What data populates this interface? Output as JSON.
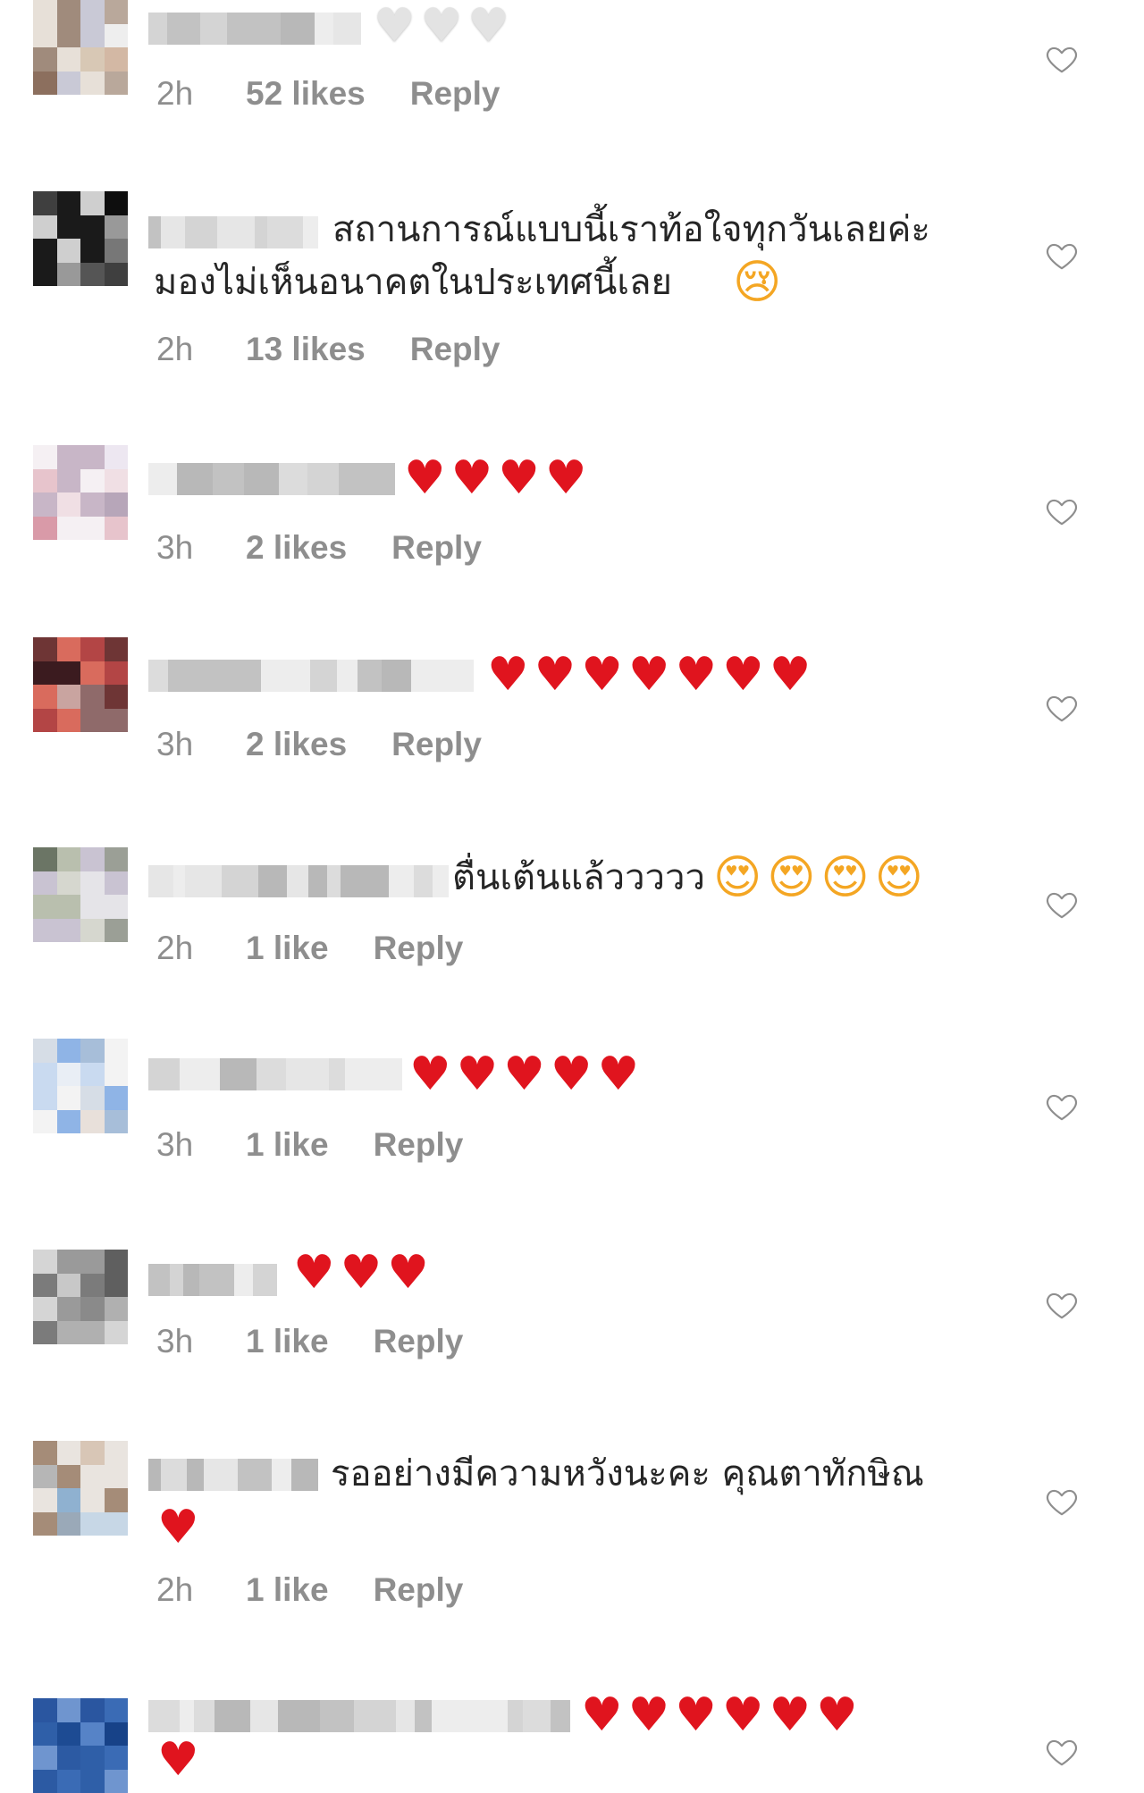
{
  "comments": [
    {
      "text": "",
      "text2": "",
      "emoji": "♥♥♥",
      "emoji_color": "white",
      "time": "2h",
      "likes": "52 likes",
      "reply": "Reply",
      "avatar_palette": [
        "#c9c9d6",
        "#b9a89b",
        "#d8c8b5",
        "#e7e0d8",
        "#a08b7c",
        "#8c6f5e",
        "#d3b8a4",
        "#eeeeee"
      ]
    },
    {
      "text": "สถานการณ์แบบนี้เราท้อใจทุกวันเลยค่ะ",
      "text2": "มองไม่เห็นอนาคตในประเทศนี้เลย",
      "emoji": "😢",
      "emoji_color": "face",
      "time": "2h",
      "likes": "13 likes",
      "reply": "Reply",
      "avatar_palette": [
        "#2b2b2b",
        "#555555",
        "#777777",
        "#1a1a1a",
        "#999999",
        "#3f3f3f",
        "#cfcfcf",
        "#0e0e0e"
      ]
    },
    {
      "text": "",
      "text2": "",
      "emoji": "♥♥♥♥",
      "emoji_color": "red",
      "time": "3h",
      "likes": "2 likes",
      "reply": "Reply",
      "avatar_palette": [
        "#e7c4cc",
        "#d99aa8",
        "#f0dfe4",
        "#c8b6c7",
        "#ede7f1",
        "#b7a6b9",
        "#d6e2ee",
        "#f5f0f3"
      ]
    },
    {
      "text": "",
      "text2": "",
      "emoji": "♥♥♥♥♥♥♥",
      "emoji_color": "red",
      "time": "3h",
      "likes": "2 likes",
      "reply": "Reply",
      "avatar_palette": [
        "#b34545",
        "#6e3535",
        "#d96b5d",
        "#3b1b1f",
        "#8f6a6a",
        "#c9a4a0",
        "#2a0d12",
        "#a7867a"
      ]
    },
    {
      "text": "ตื่นเต้นแล้ววววว",
      "text2": "",
      "emoji": "😍😍😍😍",
      "emoji_color": "face",
      "time": "2h",
      "likes": "1 like",
      "reply": "Reply",
      "avatar_palette": [
        "#8a9282",
        "#b9bfae",
        "#d6d7cf",
        "#6b7565",
        "#a6aaa0",
        "#e5e4e8",
        "#c9c3d2",
        "#9b9f96"
      ]
    },
    {
      "text": "",
      "text2": "",
      "emoji": "♥♥♥♥♥",
      "emoji_color": "red",
      "time": "3h",
      "likes": "1 like",
      "reply": "Reply",
      "avatar_palette": [
        "#c9daf0",
        "#8fb4e6",
        "#e9eef5",
        "#a7bed9",
        "#f3f3f3",
        "#d6dde6",
        "#b9c9b9",
        "#e8e0da"
      ]
    },
    {
      "text": "",
      "text2": "",
      "emoji": "♥♥♥",
      "emoji_color": "red",
      "time": "3h",
      "likes": "1 like",
      "reply": "Reply",
      "avatar_palette": [
        "#9a9a9a",
        "#5f5f5f",
        "#c8c8c8",
        "#7b7b7b",
        "#e3e3e3",
        "#b0b0b0",
        "#8a8a8a",
        "#d5d5d5"
      ]
    },
    {
      "text": "รออย่างมีความหวังนะคะ คุณตาทักษิณ",
      "text2": "",
      "emoji": "♥",
      "emoji_color": "red",
      "time": "2h",
      "likes": "1 like",
      "reply": "Reply",
      "avatar_palette": [
        "#9aa9b8",
        "#a58c78",
        "#c7d7e6",
        "#6c5a4f",
        "#8fb1d0",
        "#d8c6b6",
        "#b6b6b6",
        "#e9e4df"
      ]
    },
    {
      "text": "",
      "text2": "",
      "emoji": "♥♥♥♥♥♥",
      "emoji_color": "red",
      "time": "",
      "likes": "",
      "reply": "",
      "avatar_palette": [
        "#2f5fa8",
        "#1d4b93",
        "#5683c7",
        "#2a56a0",
        "#3a6bb5",
        "#174288",
        "#6f95cf",
        "#2c5aa3"
      ]
    }
  ],
  "trailing_emoji": "♥"
}
